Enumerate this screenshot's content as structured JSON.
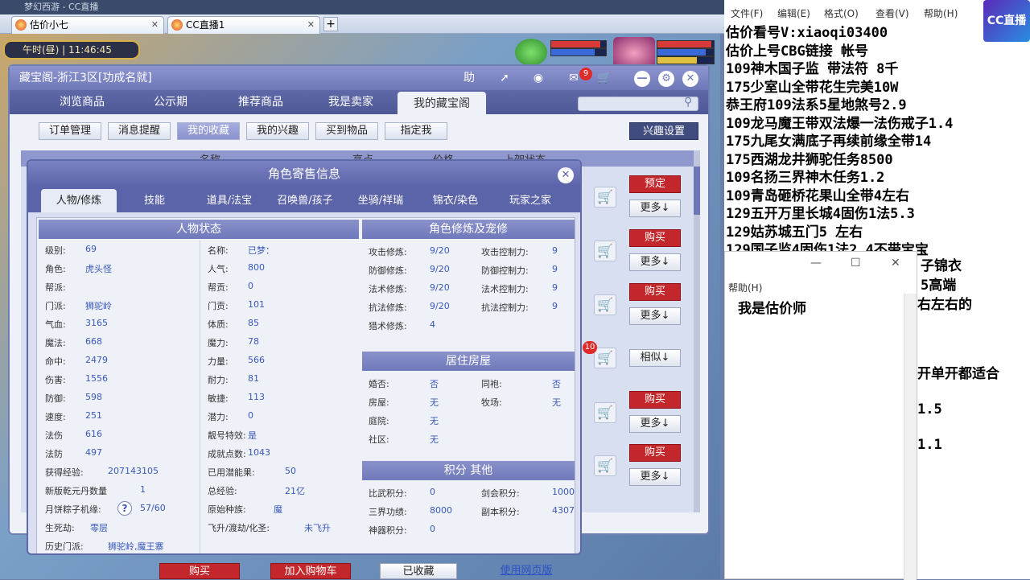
{
  "browser": {
    "title_fragment": "梦幻西游 - CC直播",
    "tabs": [
      {
        "label": "估价小七"
      },
      {
        "label": "CC直播1"
      }
    ],
    "new_tab": "+"
  },
  "game": {
    "time": "午时(昼) | 11:46:45"
  },
  "window": {
    "title": "藏宝阁-浙江3区[功成名就]",
    "help_label": "助",
    "badge_count": "9",
    "nav": [
      "浏览商品",
      "公示期",
      "推荐商品",
      "我是卖家",
      "我的藏宝阁"
    ],
    "subnav": [
      "订单管理",
      "消息提醒",
      "我的收藏",
      "我的兴趣",
      "买到物品",
      "指定我"
    ],
    "interest_btn": "兴趣设置",
    "list_headers": [
      "名称",
      "亮点",
      "价格",
      "上架状态"
    ],
    "row_buttons": [
      {
        "primary": "预定",
        "secondary": "更多↓"
      },
      {
        "primary": "购买",
        "secondary": "更多↓"
      },
      {
        "primary": "购买",
        "secondary": "更多↓"
      },
      {
        "primary": "相似↓",
        "secondary": ""
      },
      {
        "primary": "购买",
        "secondary": "更多↓"
      },
      {
        "primary": "购买",
        "secondary": "更多↓"
      }
    ],
    "row_badge": "10",
    "footer": [
      "购买",
      "加入购物车",
      "已收藏",
      "使用网页版"
    ]
  },
  "popup": {
    "title": "角色寄售信息",
    "close": "✕",
    "tabs": [
      "人物/修炼",
      "技能",
      "道具/法宝",
      "召唤兽/孩子",
      "坐骑/祥瑞",
      "锦衣/染色",
      "玩家之家"
    ],
    "status_title": "人物状态",
    "status_left": [
      {
        "label": "级别:",
        "value": "69"
      },
      {
        "label": "角色:",
        "value": "虎头怪"
      },
      {
        "label": "帮派:",
        "value": ""
      },
      {
        "label": "门派:",
        "value": "狮驼岭"
      },
      {
        "label": "气血:",
        "value": "3165"
      },
      {
        "label": "魔法:",
        "value": "668"
      },
      {
        "label": "命中:",
        "value": "2479"
      },
      {
        "label": "伤害:",
        "value": "1556"
      },
      {
        "label": "防御:",
        "value": "598"
      },
      {
        "label": "速度:",
        "value": "251"
      },
      {
        "label": "法伤",
        "value": "616"
      },
      {
        "label": "法防",
        "value": "497"
      }
    ],
    "status_right": [
      {
        "label": "名称:",
        "value": "已梦："
      },
      {
        "label": "人气:",
        "value": "800"
      },
      {
        "label": "帮贡:",
        "value": "0"
      },
      {
        "label": "门贡:",
        "value": "101"
      },
      {
        "label": "体质:",
        "value": "85"
      },
      {
        "label": "魔力:",
        "value": "78"
      },
      {
        "label": "力量:",
        "value": "566"
      },
      {
        "label": "耐力:",
        "value": "81"
      },
      {
        "label": "敏捷:",
        "value": "113"
      },
      {
        "label": "潜力:",
        "value": "0"
      },
      {
        "label": "靓号特效:",
        "value": "是"
      },
      {
        "label": "成就点数:",
        "value": "1043"
      }
    ],
    "extra": {
      "exp_label": "获得经验:",
      "exp_value": "207143105",
      "used_pot_label": "已用潜能果:",
      "used_pot_value": "50",
      "qianyuan_label": "新版乾元丹数量",
      "qianyuan_value": "1",
      "total_exp_label": "总经验:",
      "total_exp_value": "21亿",
      "mooncake_label": "月饼粽子机缘:",
      "mooncake_value": "57/60",
      "orig_race_label": "原始种族:",
      "orig_race_value": "魔",
      "life_label": "生死劫:",
      "life_value": "零层",
      "fly_label": "飞升/渡劫/化圣:",
      "fly_value": "未飞升",
      "history_label": "历史门派:",
      "history_value": "狮驼岭,魔王寨",
      "help": "?"
    },
    "cultivation_title": "角色修炼及宠修",
    "cultivation": [
      {
        "label": "攻击修炼:",
        "value": "9/20",
        "label2": "攻击控制力:",
        "value2": "9"
      },
      {
        "label": "防御修炼:",
        "value": "9/20",
        "label2": "防御控制力:",
        "value2": "9"
      },
      {
        "label": "法术修炼:",
        "value": "9/20",
        "label2": "法术控制力:",
        "value2": "9"
      },
      {
        "label": "抗法修炼:",
        "value": "9/20",
        "label2": "抗法控制力:",
        "value2": "9"
      },
      {
        "label": "猎术修炼:",
        "value": "4",
        "label2": "",
        "value2": ""
      }
    ],
    "house_title": "居住房屋",
    "house": [
      {
        "label": "婚否:",
        "value": "否",
        "label2": "同袍:",
        "value2": "否"
      },
      {
        "label": "房屋:",
        "value": "无",
        "label2": "牧场:",
        "value2": "无"
      },
      {
        "label": "庭院:",
        "value": "无",
        "label2": "",
        "value2": ""
      },
      {
        "label": "社区:",
        "value": "无",
        "label2": "",
        "value2": ""
      }
    ],
    "score_title": "积分 其他",
    "scores": [
      {
        "label": "比武积分:",
        "value": "0",
        "label2": "剑会积分:",
        "value2": "1000"
      },
      {
        "label": "三界功绩:",
        "value": "8000",
        "label2": "副本积分:",
        "value2": "4307"
      },
      {
        "label": "神器积分:",
        "value": "0",
        "label2": "",
        "value2": ""
      }
    ]
  },
  "notepad": {
    "menu": [
      "文件(F)",
      "编辑(E)",
      "格式(O)",
      "查看(V)",
      "帮助(H)"
    ],
    "lines": [
      "估价看号V:xiaoqi03400",
      "估价上号CBG链接 帐号",
      "109神木国子监 带法符 8千",
      "175少室山全带花生完美10W",
      "恭王府109法系5星地煞号2.9",
      "109龙马魔王带双法爆一法伤戒子1.4",
      "175九尾女满底子再续前缘全带14",
      "175西湖龙井狮驼任务8500",
      "109名扬三界神木任务1.2",
      "109青岛砸桥花果山全带4左右",
      "129五开万里长城4固伤1法5.3",
      "129姑苏城五门5 左右",
      "129国子监4固伤1法2.4不带宝宝"
    ],
    "partial_lines": [
      "子锦衣",
      "5高端",
      "右左右的",
      "开单开都适合",
      "1.5",
      "1.1"
    ],
    "logo": "CC直播",
    "second_window": {
      "menu": "帮助(H)",
      "text": "我是估价师",
      "min": "—",
      "max": "☐",
      "close": "✕"
    }
  }
}
